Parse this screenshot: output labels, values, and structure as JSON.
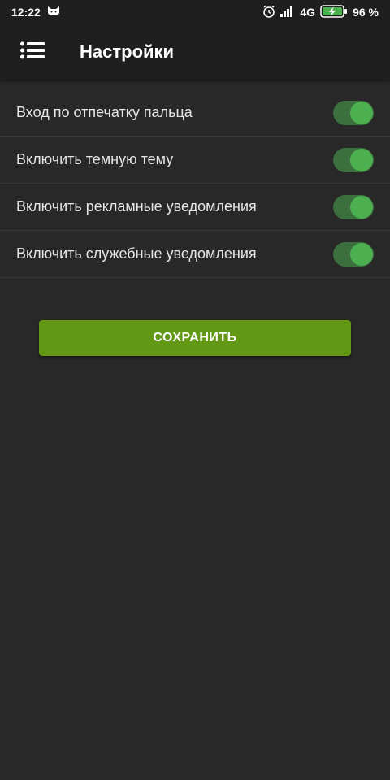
{
  "status_bar": {
    "time": "12:22",
    "network": "4G",
    "battery": "96 %",
    "icons": [
      "cat-face-icon",
      "alarm-icon",
      "signal-icon",
      "battery-charging-icon"
    ]
  },
  "app_bar": {
    "title": "Настройки",
    "menu_icon": "menu-list-icon"
  },
  "settings": [
    {
      "label": "Вход по отпечатку пальца",
      "enabled": true
    },
    {
      "label": "Включить темную тему",
      "enabled": true
    },
    {
      "label": "Включить рекламные уведомления",
      "enabled": true
    },
    {
      "label": "Включить служебные уведомления",
      "enabled": true
    }
  ],
  "save_button": {
    "label": "СОХРАНИТЬ"
  },
  "colors": {
    "background": "#282828",
    "app_bar": "#1f1f1f",
    "toggle_track": "#3b6f3d",
    "toggle_thumb": "#4caf50",
    "save_button": "#629816"
  }
}
